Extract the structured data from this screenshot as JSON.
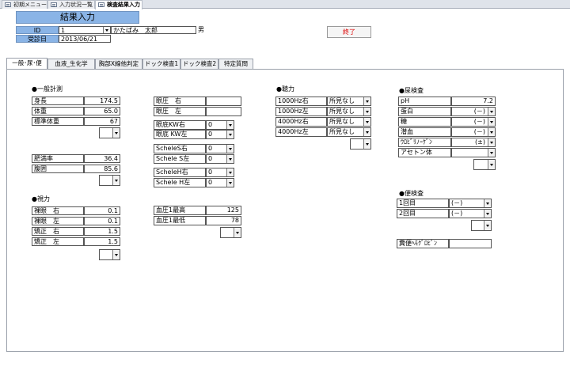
{
  "doc_tabs": [
    {
      "label": "初期メニュー",
      "active": false
    },
    {
      "label": "入力状況一覧",
      "active": false
    },
    {
      "label": "検査結果入力",
      "active": true
    }
  ],
  "header": {
    "title": "結果入力",
    "id_label": "ID",
    "id_value": "1",
    "name_value": "かたばみ　太郎",
    "sex_value": "男",
    "date_label": "受診日",
    "date_value": "2013/06/21",
    "close_button": "終了"
  },
  "form_tabs": [
    "一般･尿･便",
    "血液_生化学",
    "胸部X線他判定",
    "ドック検査1",
    "ドック検査2",
    "特定質問"
  ],
  "general": {
    "title": "●一般計測",
    "rows": [
      {
        "label": "身長",
        "value": "174.5"
      },
      {
        "label": "体重",
        "value": "65.0"
      },
      {
        "label": "標準体重",
        "value": "67"
      }
    ],
    "rows2": [
      {
        "label": "肥満率",
        "value": "36.4"
      },
      {
        "label": "腹囲",
        "value": "85.6"
      }
    ]
  },
  "vision": {
    "title": "●視力",
    "rows": [
      {
        "label": "裸眼　右",
        "value": "0.1"
      },
      {
        "label": "裸眼　左",
        "value": "0.1"
      },
      {
        "label": "矯正　右",
        "value": "1.5"
      },
      {
        "label": "矯正　左",
        "value": "1.5"
      }
    ]
  },
  "eye": {
    "rows": [
      {
        "label": "眼圧　右",
        "value": ""
      },
      {
        "label": "眼圧　左",
        "value": ""
      }
    ],
    "kw": [
      {
        "label": "眼底KW右",
        "value": "0"
      },
      {
        "label": "眼底 KW左",
        "value": "0"
      }
    ],
    "scheles": [
      {
        "label": "ScheleS右",
        "value": "0"
      },
      {
        "label": "Schele S左",
        "value": "0"
      }
    ],
    "scheleh": [
      {
        "label": "ScheleH右",
        "value": "0"
      },
      {
        "label": "Schele H左",
        "value": "0"
      }
    ]
  },
  "bp": {
    "rows": [
      {
        "label": "血圧1最高",
        "value": "125"
      },
      {
        "label": "血圧1最低",
        "value": "78"
      }
    ]
  },
  "hearing": {
    "title": "●聴力",
    "rows": [
      {
        "label": "1000Hz右",
        "value": "所見なし"
      },
      {
        "label": "1000Hz左",
        "value": "所見なし"
      },
      {
        "label": "4000Hz右",
        "value": "所見なし"
      },
      {
        "label": "4000Hz左",
        "value": "所見なし"
      }
    ]
  },
  "urine": {
    "title": "●尿検査",
    "rows": [
      {
        "label": "pH",
        "value": "7.2",
        "combo": false
      },
      {
        "label": "蛋白",
        "value": "(－)",
        "combo": true
      },
      {
        "label": "糖",
        "value": "(－)",
        "combo": true
      },
      {
        "label": "潜血",
        "value": "(－)",
        "combo": true
      },
      {
        "label": "ｳﾛﾋﾞﾘﾉｰｹﾞﾝ",
        "value": "(±)",
        "combo": true
      },
      {
        "label": "アセトン体",
        "value": "",
        "combo": true
      }
    ]
  },
  "stool": {
    "title": "●便検査",
    "rows": [
      {
        "label": "1回目",
        "value": "(－)"
      },
      {
        "label": "2回目",
        "value": "(－)"
      }
    ],
    "hemo_label": "糞便ﾍﾓｸﾞﾛﾋﾞﾝ",
    "hemo_value": ""
  }
}
